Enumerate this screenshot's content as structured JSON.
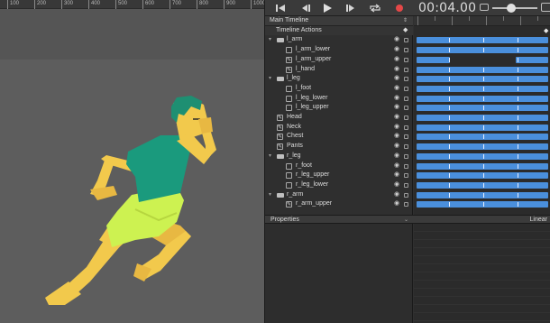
{
  "ruler": {
    "ticks": [
      "100",
      "200",
      "300",
      "400",
      "500",
      "600",
      "700",
      "800",
      "900",
      "1000"
    ]
  },
  "colors": {
    "bar": "#4a8fdc",
    "skin": "#f2c94c",
    "shirt": "#1a9a7d",
    "shorts": "#cdf251",
    "hair": "#1e8f72",
    "record": "#e54848"
  },
  "toolbar": {
    "icons": [
      "skip-to-start-icon",
      "step-back-icon",
      "play-icon",
      "step-forward-icon",
      "loop-icon",
      "record-icon"
    ],
    "timecode": "00:04.00"
  },
  "timeline": {
    "title": "Main Timeline",
    "actions_label": "Timeline Actions",
    "layers": [
      {
        "name": "l_arm",
        "type": "group",
        "indent": 0
      },
      {
        "name": "l_arm_lower",
        "type": "bone",
        "indent": 1
      },
      {
        "name": "l_arm_upper",
        "type": "image",
        "indent": 1
      },
      {
        "name": "l_hand",
        "type": "image",
        "indent": 1
      },
      {
        "name": "l_leg",
        "type": "group",
        "indent": 0
      },
      {
        "name": "l_foot",
        "type": "bone",
        "indent": 1
      },
      {
        "name": "l_leg_lower",
        "type": "bone",
        "indent": 1
      },
      {
        "name": "l_leg_upper",
        "type": "bone",
        "indent": 1
      },
      {
        "name": "Head",
        "type": "image",
        "indent": 0
      },
      {
        "name": "Neck",
        "type": "image",
        "indent": 0
      },
      {
        "name": "Chest",
        "type": "image",
        "indent": 0
      },
      {
        "name": "Pants",
        "type": "image",
        "indent": 0
      },
      {
        "name": "r_leg",
        "type": "group",
        "indent": 0
      },
      {
        "name": "r_foot",
        "type": "bone",
        "indent": 1
      },
      {
        "name": "r_leg_upper",
        "type": "bone",
        "indent": 1
      },
      {
        "name": "r_leg_lower",
        "type": "bone",
        "indent": 1
      },
      {
        "name": "r_arm",
        "type": "group",
        "indent": 0
      },
      {
        "name": "r_arm_upper",
        "type": "image",
        "indent": 1
      }
    ]
  },
  "properties": {
    "title": "Properties",
    "easing": "Linear"
  }
}
